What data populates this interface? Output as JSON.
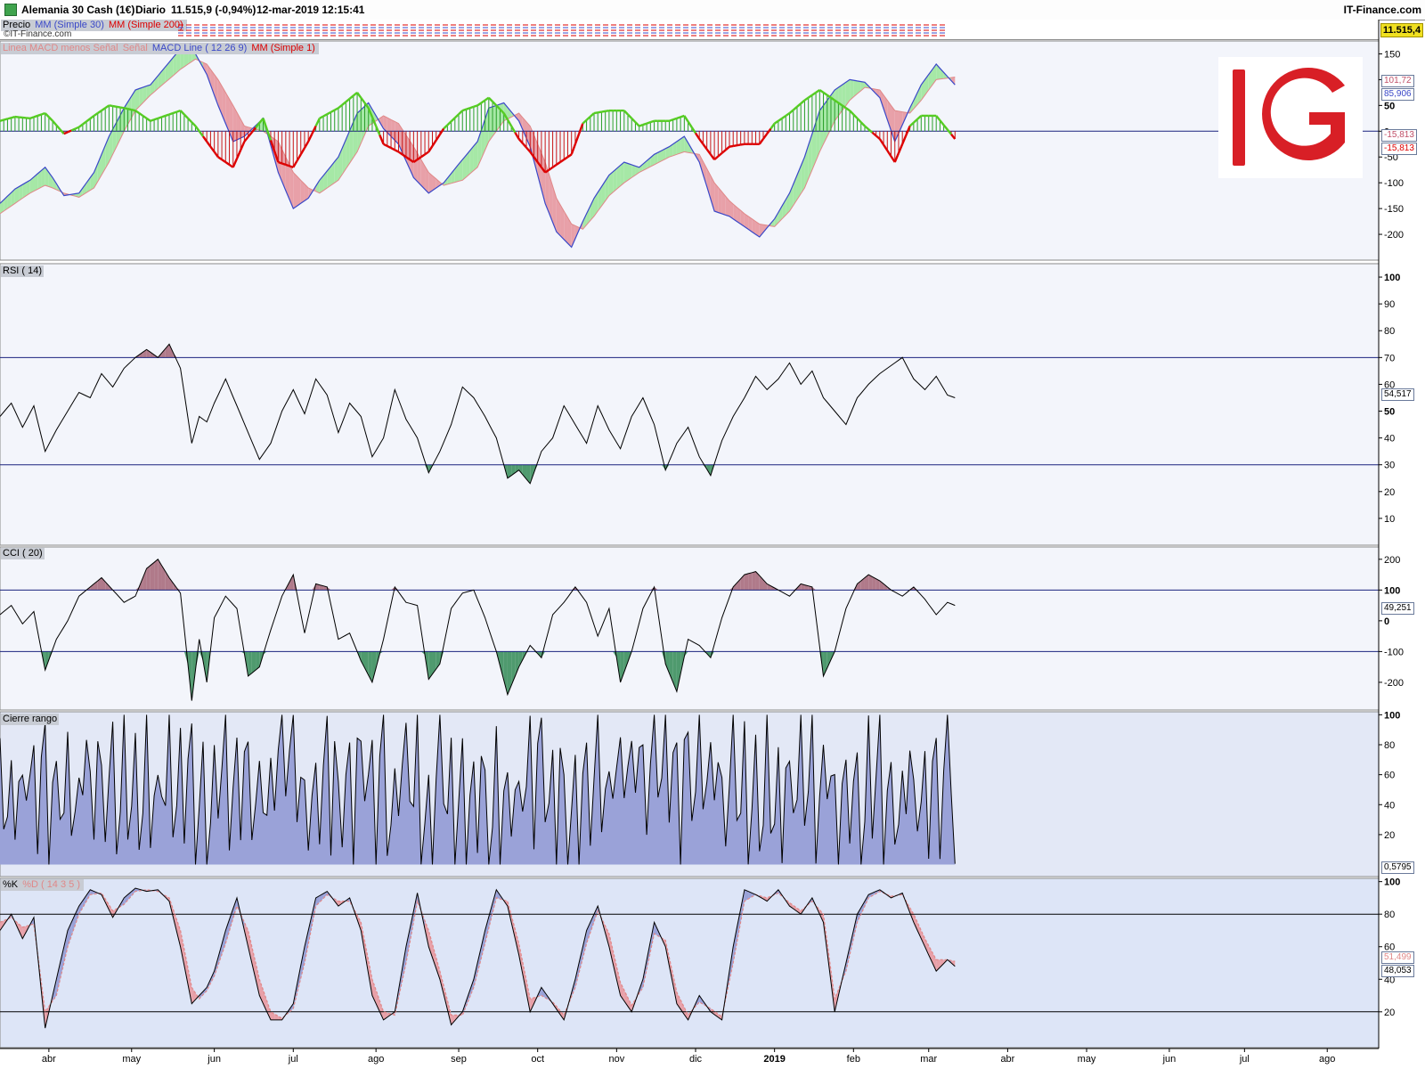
{
  "header": {
    "instrument": "Alemania 30 Cash (1€)",
    "period": "Diario",
    "price_change": "11.515,9 (-0,94%)",
    "datetime": "12-mar-2019 12:15:41",
    "brand": "IT-Finance.com"
  },
  "price_panel": {
    "labels": [
      "Precio",
      "MM (Simple 30)",
      "MM (Simple 200)"
    ],
    "watermark": "©IT-Finance.com",
    "last_price": "11.515,4"
  },
  "logo": {
    "text": "IG",
    "color": "#d81f26"
  },
  "colors": {
    "panel_bg": "#f3f5fb",
    "stoch_bg": "#dde5f7",
    "range_fill": "#9aa2d8",
    "axis_line": "#000000",
    "level_line": "#1a237e",
    "green_fill": "#a6e8a6",
    "red_fill": "#e8a0a8",
    "macd_line": "#3a48c8",
    "signal_line": "#e08888",
    "histo_green": "#2aa02a",
    "histo_red": "#c81818",
    "mm1_line": "#dd0000",
    "rsi_low_fill": "#4f9a6e",
    "rsi_high_fill": "#b07a8a"
  },
  "x_axis": {
    "labels": [
      "abr",
      "may",
      "jun",
      "jul",
      "ago",
      "sep",
      "oct",
      "nov",
      "dic",
      "2019",
      "feb",
      "mar",
      "abr",
      "may",
      "jun",
      "jul",
      "ago"
    ],
    "bold_label": "2019"
  },
  "chart_data": [
    {
      "type": "line",
      "name": "MACD",
      "legend": [
        "Linea MACD menos Señal",
        "Señal",
        "MACD Line ( 12 26 9)",
        "MM (Simple 1)"
      ],
      "ylim": [
        -250,
        175
      ],
      "yticks": [
        150,
        100,
        50,
        0,
        -50,
        -100,
        -150,
        -200
      ],
      "last_values": [
        "101,72",
        "85,906",
        "-15,813",
        "-15,813"
      ],
      "x": [
        0,
        4,
        8,
        12,
        14,
        17,
        21,
        25,
        29,
        33,
        36,
        40,
        44,
        48,
        52,
        55,
        58,
        62,
        65,
        70,
        74,
        78,
        82,
        85,
        90,
        95,
        98,
        102,
        106,
        110,
        114,
        118,
        123,
        127,
        130,
        134,
        138,
        141,
        145,
        148,
        152,
        155,
        158,
        162,
        166,
        170,
        174,
        178,
        182,
        186,
        190,
        194,
        198,
        202,
        206,
        210,
        214,
        218,
        222,
        226,
        230,
        234,
        238,
        242,
        245,
        249,
        254
      ],
      "macd": [
        -140,
        -112,
        -95,
        -70,
        -90,
        -125,
        -120,
        -80,
        -10,
        45,
        80,
        90,
        125,
        160,
        150,
        110,
        50,
        -20,
        -10,
        25,
        -80,
        -150,
        -130,
        -95,
        -50,
        35,
        55,
        5,
        -25,
        -90,
        -120,
        -100,
        -55,
        -20,
        45,
        55,
        20,
        -30,
        -140,
        -195,
        -225,
        -175,
        -130,
        -85,
        -60,
        -70,
        -45,
        -30,
        -10,
        -60,
        -155,
        -165,
        -185,
        -205,
        -170,
        -120,
        -50,
        40,
        80,
        100,
        95,
        65,
        -20,
        45,
        90,
        130,
        90
      ],
      "signal": [
        -160,
        -140,
        -120,
        -105,
        -110,
        -120,
        -128,
        -110,
        -60,
        0,
        40,
        70,
        95,
        120,
        140,
        130,
        100,
        50,
        10,
        0,
        -20,
        -80,
        -110,
        -120,
        -95,
        -40,
        10,
        30,
        15,
        -30,
        -80,
        -105,
        -95,
        -70,
        -20,
        20,
        35,
        10,
        -60,
        -130,
        -180,
        -190,
        -165,
        -125,
        -100,
        -80,
        -65,
        -50,
        -40,
        -45,
        -100,
        -135,
        -160,
        -180,
        -185,
        -155,
        -110,
        -40,
        20,
        60,
        85,
        80,
        40,
        35,
        60,
        100,
        105
      ],
      "histogram": [
        20,
        28,
        25,
        35,
        20,
        -5,
        8,
        30,
        50,
        45,
        40,
        20,
        30,
        40,
        10,
        -20,
        -50,
        -70,
        -20,
        25,
        -60,
        -70,
        -20,
        25,
        45,
        75,
        45,
        -25,
        -40,
        -60,
        -40,
        5,
        40,
        50,
        65,
        35,
        -15,
        -40,
        -80,
        -65,
        -45,
        15,
        35,
        40,
        40,
        10,
        20,
        20,
        30,
        -15,
        -55,
        -30,
        -25,
        -25,
        15,
        35,
        60,
        80,
        60,
        40,
        10,
        -15,
        -60,
        10,
        30,
        30,
        -15
      ]
    },
    {
      "type": "line",
      "name": "RSI ( 14)",
      "ylim": [
        0,
        105
      ],
      "yticks": [
        100,
        90,
        80,
        70,
        60,
        50,
        40,
        30,
        20,
        10
      ],
      "levels": [
        70,
        30
      ],
      "last_value": "54,517",
      "x": [
        0,
        3,
        6,
        9,
        12,
        15,
        18,
        21,
        24,
        27,
        30,
        33,
        36,
        39,
        42,
        45,
        48,
        51,
        53,
        55,
        57,
        60,
        63,
        66,
        69,
        72,
        75,
        78,
        81,
        84,
        87,
        90,
        93,
        96,
        99,
        102,
        105,
        108,
        111,
        114,
        117,
        120,
        123,
        126,
        129,
        132,
        135,
        138,
        141,
        144,
        147,
        150,
        153,
        156,
        159,
        162,
        165,
        168,
        171,
        174,
        177,
        180,
        183,
        186,
        189,
        192,
        195,
        198,
        201,
        204,
        207,
        210,
        213,
        216,
        219,
        222,
        225,
        228,
        231,
        234,
        237,
        240,
        243,
        246,
        249,
        252,
        254
      ],
      "values": [
        48,
        53,
        44,
        52,
        35,
        43,
        50,
        57,
        55,
        64,
        59,
        66,
        70,
        73,
        70,
        75,
        66,
        38,
        48,
        46,
        53,
        62,
        52,
        42,
        32,
        38,
        50,
        58,
        49,
        62,
        56,
        42,
        53,
        48,
        33,
        40,
        58,
        47,
        40,
        27,
        35,
        45,
        59,
        55,
        48,
        40,
        25,
        28,
        23,
        35,
        40,
        52,
        45,
        38,
        52,
        43,
        36,
        48,
        55,
        45,
        28,
        38,
        44,
        33,
        26,
        39,
        48,
        55,
        63,
        58,
        62,
        68,
        60,
        65,
        55,
        50,
        45,
        55,
        60,
        64,
        67,
        70,
        62,
        58,
        63,
        56,
        55
      ],
      "values_note": "approximate daily RSI path Mar 2018 – Mar 2019"
    },
    {
      "type": "line",
      "name": "CCI ( 20)",
      "ylim": [
        -290,
        240
      ],
      "yticks": [
        200,
        100,
        0,
        -100,
        -200
      ],
      "levels": [
        100,
        -100
      ],
      "last_value": "49,251",
      "x": [
        0,
        3,
        6,
        9,
        12,
        15,
        18,
        21,
        24,
        27,
        30,
        33,
        36,
        39,
        42,
        45,
        48,
        51,
        53,
        55,
        57,
        60,
        63,
        66,
        69,
        72,
        75,
        78,
        81,
        84,
        87,
        90,
        93,
        96,
        99,
        102,
        105,
        108,
        111,
        114,
        117,
        120,
        123,
        126,
        129,
        132,
        135,
        138,
        141,
        144,
        147,
        150,
        153,
        156,
        159,
        162,
        165,
        168,
        171,
        174,
        177,
        180,
        183,
        186,
        189,
        192,
        195,
        198,
        201,
        204,
        207,
        210,
        213,
        216,
        219,
        222,
        225,
        228,
        231,
        234,
        237,
        240,
        243,
        246,
        249,
        252,
        254
      ],
      "values": [
        20,
        50,
        -10,
        30,
        -160,
        -60,
        0,
        80,
        110,
        140,
        100,
        60,
        80,
        170,
        200,
        140,
        90,
        -260,
        -60,
        -200,
        10,
        80,
        40,
        -180,
        -150,
        -30,
        80,
        150,
        -40,
        120,
        110,
        -60,
        -40,
        -130,
        -200,
        -60,
        110,
        60,
        50,
        -190,
        -140,
        40,
        90,
        100,
        10,
        -100,
        -240,
        -150,
        -80,
        -120,
        20,
        60,
        110,
        60,
        -50,
        40,
        -200,
        -100,
        40,
        110,
        -140,
        -230,
        -60,
        -80,
        -120,
        10,
        110,
        150,
        160,
        120,
        100,
        80,
        120,
        110,
        -180,
        -100,
        40,
        120,
        150,
        130,
        100,
        80,
        110,
        70,
        20,
        60,
        50
      ]
    },
    {
      "type": "area",
      "name": "Cierre rango",
      "ylim": [
        -8,
        102
      ],
      "yticks": [
        100,
        80,
        60,
        40,
        20
      ],
      "last_value": "0,5795",
      "values_note": "daily close position within range (0-100), oscillating"
    },
    {
      "type": "line",
      "name": "%K",
      "legend": [
        "%K",
        "%D ( 14 3 5 )"
      ],
      "ylim": [
        -2,
        102
      ],
      "yticks": [
        100,
        80,
        60,
        40,
        20
      ],
      "levels": [
        80,
        20
      ],
      "last_values": [
        "51,499",
        "48,053"
      ],
      "x": [
        0,
        3,
        6,
        9,
        12,
        15,
        18,
        21,
        24,
        27,
        30,
        33,
        36,
        39,
        42,
        45,
        48,
        51,
        53,
        55,
        57,
        60,
        63,
        66,
        69,
        72,
        75,
        78,
        81,
        84,
        87,
        90,
        93,
        96,
        99,
        102,
        105,
        108,
        111,
        114,
        117,
        120,
        123,
        126,
        129,
        132,
        135,
        138,
        141,
        144,
        147,
        150,
        153,
        156,
        159,
        162,
        165,
        168,
        171,
        174,
        177,
        180,
        183,
        186,
        189,
        192,
        195,
        198,
        201,
        204,
        207,
        210,
        213,
        216,
        219,
        222,
        225,
        228,
        231,
        234,
        237,
        240,
        243,
        246,
        249,
        252,
        254
      ],
      "k": [
        70,
        80,
        65,
        78,
        10,
        40,
        70,
        85,
        95,
        92,
        78,
        90,
        96,
        94,
        95,
        88,
        60,
        25,
        30,
        35,
        45,
        70,
        90,
        60,
        30,
        15,
        15,
        25,
        60,
        90,
        94,
        85,
        90,
        70,
        30,
        15,
        20,
        60,
        93,
        60,
        40,
        12,
        20,
        40,
        70,
        95,
        85,
        55,
        20,
        35,
        25,
        15,
        40,
        70,
        85,
        60,
        30,
        20,
        40,
        75,
        60,
        25,
        15,
        30,
        20,
        15,
        60,
        95,
        92,
        88,
        95,
        85,
        80,
        90,
        75,
        20,
        50,
        80,
        92,
        95,
        90,
        93,
        75,
        60,
        45,
        52,
        48
      ],
      "d": [
        75,
        78,
        72,
        74,
        20,
        30,
        60,
        80,
        92,
        93,
        82,
        86,
        94,
        95,
        94,
        90,
        70,
        35,
        28,
        33,
        42,
        62,
        85,
        70,
        40,
        20,
        16,
        22,
        50,
        85,
        92,
        88,
        88,
        75,
        40,
        20,
        18,
        50,
        88,
        70,
        45,
        18,
        18,
        35,
        62,
        90,
        88,
        62,
        28,
        30,
        26,
        18,
        35,
        62,
        82,
        68,
        38,
        24,
        35,
        68,
        64,
        32,
        18,
        26,
        22,
        17,
        50,
        88,
        92,
        90,
        93,
        87,
        82,
        88,
        80,
        28,
        45,
        75,
        90,
        94,
        91,
        92,
        80,
        65,
        52,
        52,
        51
      ]
    }
  ]
}
